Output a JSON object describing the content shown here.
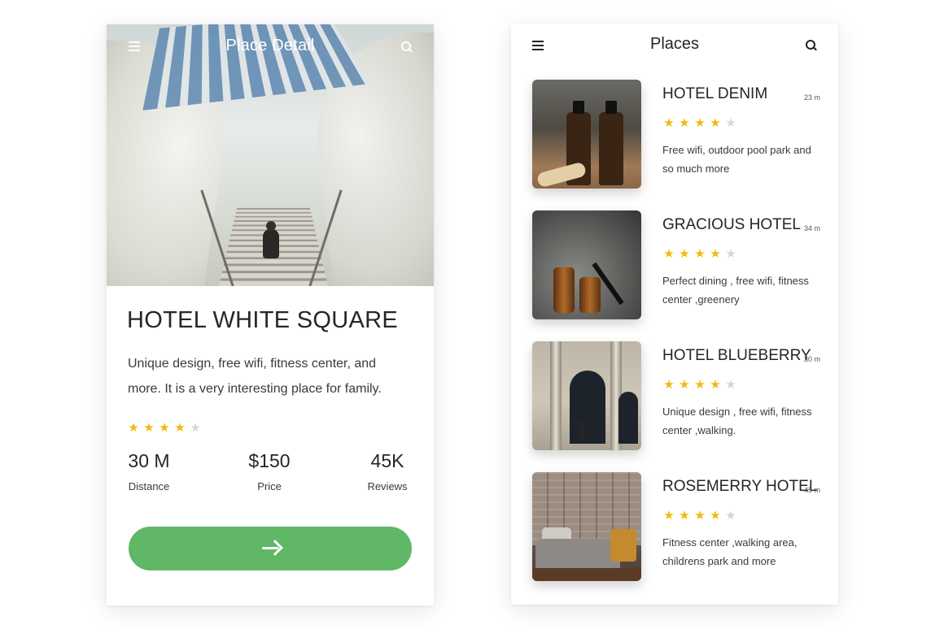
{
  "detail": {
    "nav_title": "Place Detail",
    "hotel_name": "HOTEL WHITE SQUARE",
    "description": "Unique design, free wifi, fitness center,  and more. It is a very interesting place for family.",
    "rating": 4,
    "rating_max": 5,
    "stats": {
      "distance": {
        "value": "30 M",
        "label": "Distance"
      },
      "price": {
        "value": "$150",
        "label": "Price"
      },
      "reviews": {
        "value": "45K",
        "label": "Reviews"
      }
    },
    "go_button": {
      "icon": "arrow-right-icon"
    }
  },
  "list": {
    "nav_title": "Places",
    "items": [
      {
        "name": "HOTEL DENIM",
        "distance": "23 m",
        "rating": 4,
        "description": "Free  wifi, outdoor pool park and so much more"
      },
      {
        "name": "GRACIOUS HOTEL",
        "distance": "34 m",
        "rating": 4,
        "description": "Perfect dining , free  wifi, fitness center ,greenery"
      },
      {
        "name": "HOTEL BLUEBERRY",
        "distance": "30 m",
        "rating": 4,
        "description": "Unique design , free  wifi, fitness center ,walking."
      },
      {
        "name": "ROSEMERRY HOTEL",
        "distance": "45 m",
        "rating": 4,
        "description": "Fitness center ,walking area, childrens park and more"
      }
    ]
  },
  "icons": {
    "menu": "menu-icon",
    "search": "search-icon",
    "star": "star-icon"
  },
  "colors": {
    "accent_green": "#60b766",
    "star_on": "#f3b80f",
    "star_off": "#d6d6d6"
  }
}
